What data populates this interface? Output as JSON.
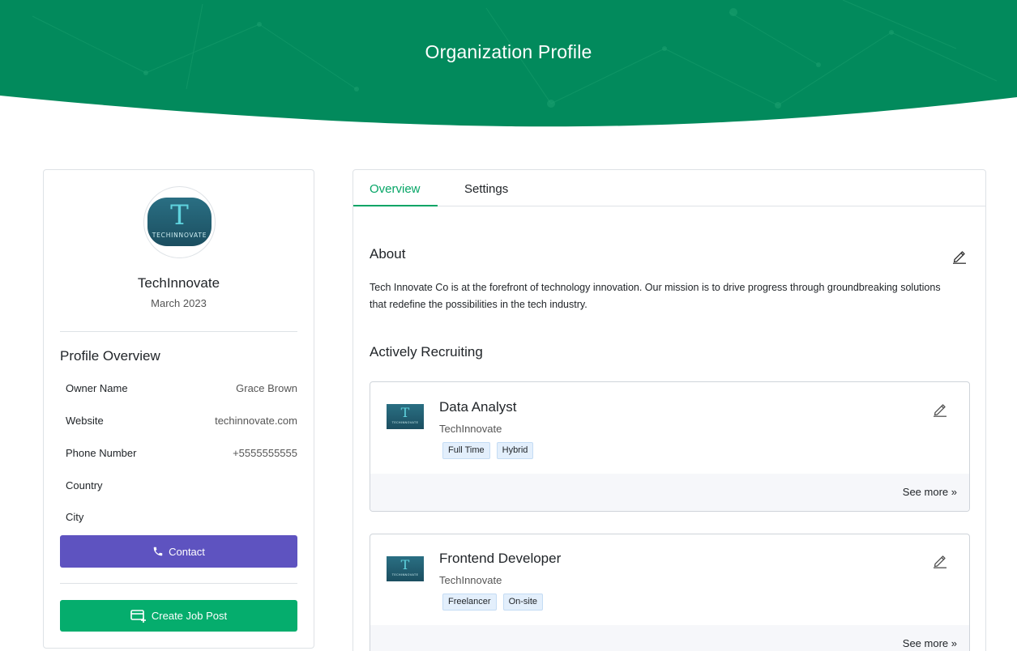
{
  "header": {
    "title": "Organization Profile",
    "bg_color": "#028a5c"
  },
  "organization": {
    "logo_text": "TECHINNOVATE",
    "logo_letter": "T",
    "name": "TechInnovate",
    "joined": "March 2023"
  },
  "profile_overview": {
    "title": "Profile Overview",
    "rows": [
      {
        "label": "Owner Name",
        "value": "Grace Brown"
      },
      {
        "label": "Website",
        "value": "techinnovate.com"
      },
      {
        "label": "Phone Number",
        "value": "+5555555555"
      },
      {
        "label": "Country",
        "value": ""
      },
      {
        "label": "City",
        "value": ""
      }
    ]
  },
  "buttons": {
    "contact": {
      "label": "Contact",
      "icon": "phone-icon",
      "color": "#5e53c0"
    },
    "create_job": {
      "label": "Create Job Post",
      "icon": "card-plus-icon",
      "color": "#05ad6d"
    }
  },
  "tabs": [
    {
      "label": "Overview",
      "active": true
    },
    {
      "label": "Settings",
      "active": false
    }
  ],
  "accent_color": "#05a566",
  "about": {
    "title": "About",
    "text": "Tech Innovate Co is at the forefront of technology innovation. Our mission is to drive progress through groundbreaking solutions that redefine the possibilities in the tech industry."
  },
  "recruiting": {
    "title": "Actively Recruiting",
    "jobs": [
      {
        "title": "Data Analyst",
        "company": "TechInnovate",
        "tags": [
          "Full Time",
          "Hybrid"
        ],
        "see_more": "See more"
      },
      {
        "title": "Frontend Developer",
        "company": "TechInnovate",
        "tags": [
          "Freelancer",
          "On-site"
        ],
        "see_more": "See more"
      }
    ]
  }
}
